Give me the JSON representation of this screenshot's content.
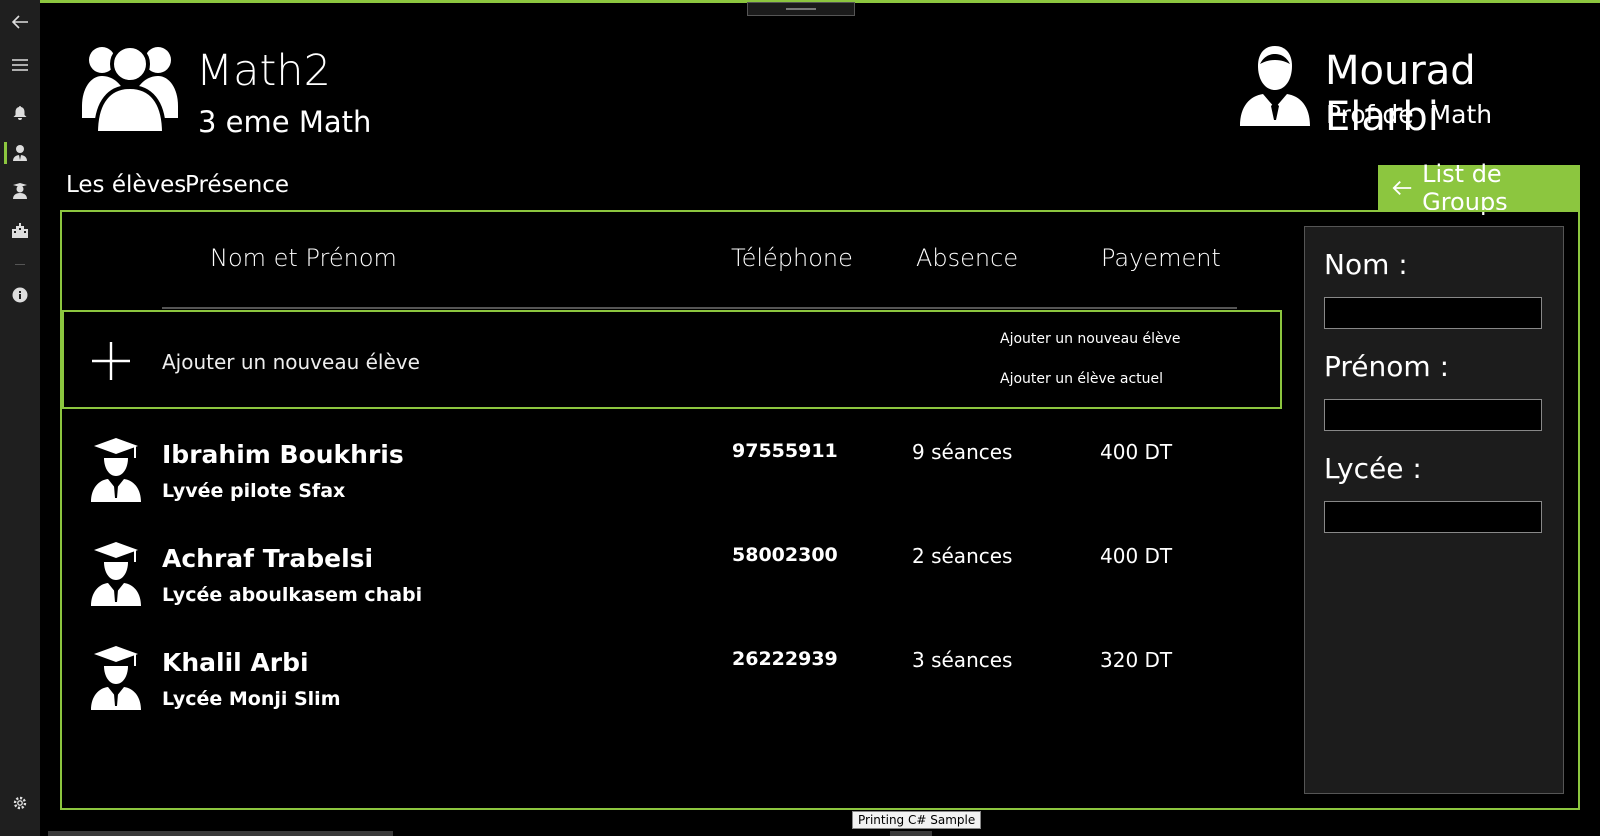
{
  "nav": {
    "items": [
      {
        "icon": "back-arrow-icon"
      },
      {
        "icon": "hamburger-icon"
      },
      {
        "icon": "bell-icon"
      },
      {
        "icon": "teacher-icon",
        "selected": true
      },
      {
        "icon": "student-icon"
      },
      {
        "icon": "building-icon"
      },
      {
        "icon": "info-icon"
      },
      {
        "icon": "gear-icon"
      }
    ]
  },
  "header": {
    "group_name": "Math2",
    "group_level": "3 eme Math",
    "teacher_name": "Mourad Elarbi",
    "teacher_role": "Prof de  Math"
  },
  "tabs": [
    {
      "label": "Les élèves"
    },
    {
      "label": "Présence"
    }
  ],
  "groups_button": {
    "label": "List de Groups",
    "icon": "arrow-left-icon"
  },
  "table": {
    "columns": [
      "Nom et Prénom",
      "Téléphone",
      "Absence",
      "Payement"
    ],
    "add_row": {
      "label": "Ajouter un nouveau élève",
      "options": [
        "Ajouter un nouveau élève",
        "Ajouter un élève actuel"
      ]
    },
    "students": [
      {
        "name": "Ibrahim Boukhris",
        "school": "Lyvée pilote Sfax",
        "phone": "97555911",
        "absence": "9 séances",
        "payment": "400 DT"
      },
      {
        "name": "Achraf Trabelsi",
        "school": "Lycée aboulkasem chabi",
        "phone": "58002300",
        "absence": "2 séances",
        "payment": "400 DT"
      },
      {
        "name": "Khalil Arbi",
        "school": "Lycée Monji Slim",
        "phone": "26222939",
        "absence": "3 séances",
        "payment": "320 DT"
      }
    ]
  },
  "form": {
    "nom_label": "Nom :",
    "prenom_label": "Prénom :",
    "lycee_label": "Lycée :",
    "nom_value": "",
    "prenom_value": "",
    "lycee_value": ""
  },
  "tooltip": "Printing C# Sample",
  "colors": {
    "accent": "#8cc63f",
    "background": "#000000",
    "panel": "#1c1c1c"
  }
}
